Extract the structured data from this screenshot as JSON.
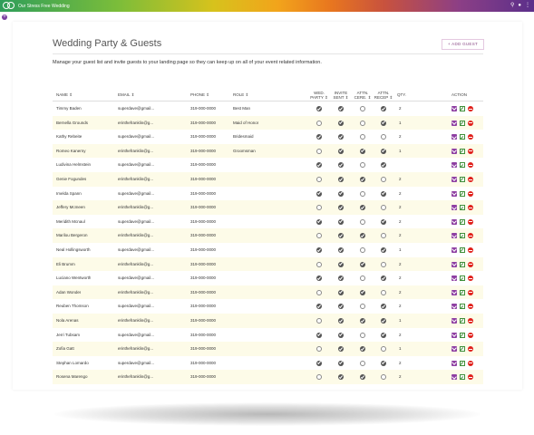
{
  "app": {
    "brand_name": "Our Stress Free Wedding"
  },
  "header": {
    "icons": [
      "search-icon",
      "info-icon",
      "more-vertical-icon"
    ]
  },
  "page": {
    "title": "Wedding Party & Guests",
    "add_guest_label": "+ ADD GUEST",
    "description": "Manage your guest list and invite guests to your landing page so they can keep up on all of your event related information."
  },
  "table": {
    "columns": {
      "name": "NAME ⇕",
      "email": "EMAIL ⇕",
      "phone": "PHONE ⇕",
      "role": "ROLE ⇕",
      "wed_party_1": "WED.",
      "wed_party_2": "PARTY ⇕",
      "invite_1": "INVITE",
      "invite_2": "SENT ⇕",
      "attn_cere_1": "ATTN.",
      "attn_cere_2": "CERE. ⇕",
      "attn_recep_1": "ATTN.",
      "attn_recep_2": "RECEP ⇕",
      "qty": "QTY.",
      "action": "ACTION"
    },
    "rows": [
      {
        "name": "Timmy Baden",
        "email": "superdave@gmail...",
        "phone": "319-000-0000",
        "role": "Best Man",
        "wed_party": true,
        "invite_sent": true,
        "attn_cere": false,
        "attn_recep": true,
        "qty": "2"
      },
      {
        "name": "Bernella Grounds",
        "email": "erinthefranklin@g...",
        "phone": "319-000-0000",
        "role": "Maid of Honor",
        "wed_party": false,
        "invite_sent": true,
        "attn_cere": false,
        "attn_recep": true,
        "qty": "1"
      },
      {
        "name": "Kathy Rebeite",
        "email": "superdave@gmail...",
        "phone": "319-000-0000",
        "role": "Bridesmaid",
        "wed_party": true,
        "invite_sent": true,
        "attn_cere": false,
        "attn_recep": false,
        "qty": "2"
      },
      {
        "name": "Romeo Kanerny",
        "email": "erinthefranklin@g...",
        "phone": "319-000-0000",
        "role": "Groomsman",
        "wed_party": false,
        "invite_sent": true,
        "attn_cere": true,
        "attn_recep": true,
        "qty": "1"
      },
      {
        "name": "Ludivina Helmstein",
        "email": "superdave@gmail...",
        "phone": "319-000-0000",
        "role": "",
        "wed_party": true,
        "invite_sent": true,
        "attn_cere": false,
        "attn_recep": true,
        "qty": ""
      },
      {
        "name": "Genie Fogundes",
        "email": "erinthefranklin@g...",
        "phone": "319-000-0000",
        "role": "",
        "wed_party": false,
        "invite_sent": true,
        "attn_cere": true,
        "attn_recep": false,
        "qty": "2"
      },
      {
        "name": "Imelda Spann",
        "email": "superdave@gmail...",
        "phone": "319-000-0000",
        "role": "",
        "wed_party": true,
        "invite_sent": true,
        "attn_cere": false,
        "attn_recep": true,
        "qty": "2"
      },
      {
        "name": "Jeffery Mcmeen",
        "email": "erinthefranklin@g...",
        "phone": "319-000-0000",
        "role": "",
        "wed_party": false,
        "invite_sent": true,
        "attn_cere": true,
        "attn_recep": false,
        "qty": "2"
      },
      {
        "name": "Meridith Mcnaul",
        "email": "superdave@gmail...",
        "phone": "319-000-0000",
        "role": "",
        "wed_party": true,
        "invite_sent": true,
        "attn_cere": false,
        "attn_recep": true,
        "qty": "2"
      },
      {
        "name": "Marilou Bergeron",
        "email": "erinthefranklin@g...",
        "phone": "319-000-0000",
        "role": "",
        "wed_party": false,
        "invite_sent": true,
        "attn_cere": true,
        "attn_recep": false,
        "qty": "2"
      },
      {
        "name": "Neal Hollingsworth",
        "email": "superdave@gmail...",
        "phone": "319-000-0000",
        "role": "",
        "wed_party": true,
        "invite_sent": true,
        "attn_cere": false,
        "attn_recep": true,
        "qty": "1"
      },
      {
        "name": "Eli Brumm",
        "email": "erinthefranklin@g...",
        "phone": "319-000-0000",
        "role": "",
        "wed_party": false,
        "invite_sent": true,
        "attn_cere": true,
        "attn_recep": false,
        "qty": "2"
      },
      {
        "name": "Luciano Wentworth",
        "email": "superdave@gmail...",
        "phone": "319-000-0000",
        "role": "",
        "wed_party": true,
        "invite_sent": true,
        "attn_cere": false,
        "attn_recep": true,
        "qty": "2"
      },
      {
        "name": "Adan Wonder",
        "email": "erinthefranklin@g...",
        "phone": "319-000-0000",
        "role": "",
        "wed_party": false,
        "invite_sent": true,
        "attn_cere": true,
        "attn_recep": false,
        "qty": "2"
      },
      {
        "name": "Reuben Thomson",
        "email": "superdave@gmail...",
        "phone": "319-000-0000",
        "role": "",
        "wed_party": true,
        "invite_sent": true,
        "attn_cere": false,
        "attn_recep": true,
        "qty": "2"
      },
      {
        "name": "Nola Arenas",
        "email": "erinthefranklin@g...",
        "phone": "319-000-0000",
        "role": "",
        "wed_party": false,
        "invite_sent": true,
        "attn_cere": true,
        "attn_recep": true,
        "qty": "1"
      },
      {
        "name": "Jerri Tubsam",
        "email": "superdave@gmail...",
        "phone": "319-000-0000",
        "role": "",
        "wed_party": true,
        "invite_sent": true,
        "attn_cere": false,
        "attn_recep": true,
        "qty": "2"
      },
      {
        "name": "Zofia Gatt",
        "email": "erinthefranklin@g...",
        "phone": "319-000-0000",
        "role": "",
        "wed_party": false,
        "invite_sent": true,
        "attn_cere": true,
        "attn_recep": false,
        "qty": "1"
      },
      {
        "name": "Stephan Lomardo",
        "email": "superdave@gmail...",
        "phone": "319-000-0000",
        "role": "",
        "wed_party": true,
        "invite_sent": true,
        "attn_cere": false,
        "attn_recep": true,
        "qty": "2"
      },
      {
        "name": "Rosena Marengo",
        "email": "erinthefranklin@g...",
        "phone": "319-000-0000",
        "role": "",
        "wed_party": false,
        "invite_sent": true,
        "attn_cere": true,
        "attn_recep": false,
        "qty": "2"
      }
    ]
  },
  "colors": {
    "accent": "#8e3fa2",
    "edit_icon": "#3f8f3a",
    "delete_icon": "#e0201b",
    "alt_row": "#fdfbe8"
  }
}
